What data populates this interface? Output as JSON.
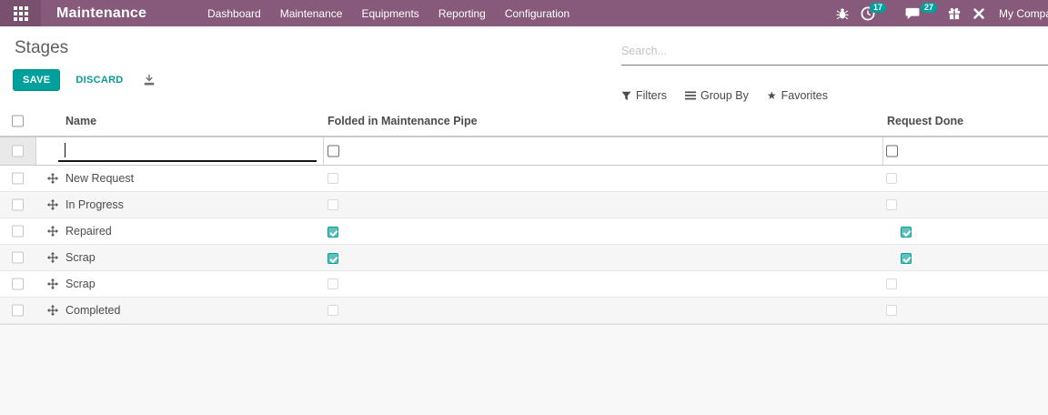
{
  "topbar": {
    "brand": "Maintenance",
    "menu": [
      "Dashboard",
      "Maintenance",
      "Equipments",
      "Reporting",
      "Configuration"
    ],
    "systray": {
      "activities_count": "17",
      "messages_count": "27",
      "user": "My Company"
    },
    "colors": {
      "bar": "#875a7b",
      "accent": "#00a09d"
    }
  },
  "control_panel": {
    "breadcrumb": "Stages",
    "save_label": "SAVE",
    "discard_label": "DISCARD",
    "search_placeholder": "Search...",
    "filters_label": "Filters",
    "group_by_label": "Group By",
    "favorites_label": "Favorites"
  },
  "icons": {
    "favorites_star": "★"
  },
  "table": {
    "columns": [
      "Name",
      "Folded in Maintenance Pipe",
      "Request Done"
    ],
    "new_row": {
      "name_value": ""
    },
    "rows": [
      {
        "name": "New Request",
        "folded": false,
        "request_done": false
      },
      {
        "name": "In Progress",
        "folded": false,
        "request_done": false
      },
      {
        "name": "Repaired",
        "folded": true,
        "request_done": true
      },
      {
        "name": "Scrap",
        "folded": true,
        "request_done": true
      },
      {
        "name": "Scrap",
        "folded": false,
        "request_done": false
      },
      {
        "name": "Completed",
        "folded": false,
        "request_done": false
      }
    ]
  }
}
